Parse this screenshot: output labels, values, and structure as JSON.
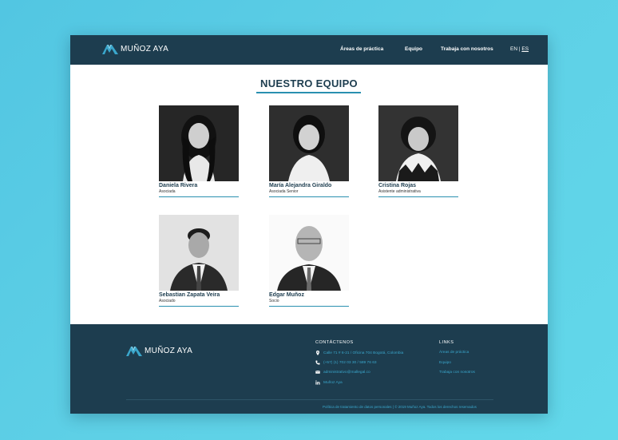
{
  "brand": {
    "name": "MUÑOZ AYA",
    "accent": "#2a90b0",
    "navy": "#1d3d4f",
    "link": "#3aa7cc"
  },
  "nav": {
    "items": [
      {
        "label": "Áreas de práctica"
      },
      {
        "label": "Equipo"
      },
      {
        "label": "Trabaja con nosotros"
      }
    ],
    "lang_en": "EN",
    "lang_sep": "|",
    "lang_es": "ES"
  },
  "main": {
    "title": "NUESTRO EQUIPO",
    "team": [
      {
        "name": "Daniela Rivera",
        "role": "Asociada"
      },
      {
        "name": "María Alejandra Giraldo",
        "role": "Asociada Senior"
      },
      {
        "name": "Cristina Rojas",
        "role": "Asistente administrativa"
      },
      {
        "name": "Sebastian Zapata Veira",
        "role": "Asociado"
      },
      {
        "name": "Edgar Muñoz",
        "role": "Socio"
      }
    ]
  },
  "footer": {
    "contact_heading": "CONTÁCTENOS",
    "contact": [
      {
        "icon": "location-pin-icon",
        "text": "Calle 71 # 6-21 / Oficina 704 Bogotá, Colombia"
      },
      {
        "icon": "phone-icon",
        "text": "(+57) (1) 702 03 30 / 589 76 63"
      },
      {
        "icon": "mail-icon",
        "text": "administrativo@mallegal.co"
      },
      {
        "icon": "linkedin-icon",
        "text": "Muñoz Aya"
      }
    ],
    "links_heading": "LINKS",
    "links": [
      {
        "label": "Áreas de práctica"
      },
      {
        "label": "Equipo"
      },
      {
        "label": "Trabaja con nosotros"
      }
    ],
    "copyright": "Política de tratamiento de datos personales  |  © 2019 Muñoz Aya. Todos los derechos reservados"
  }
}
